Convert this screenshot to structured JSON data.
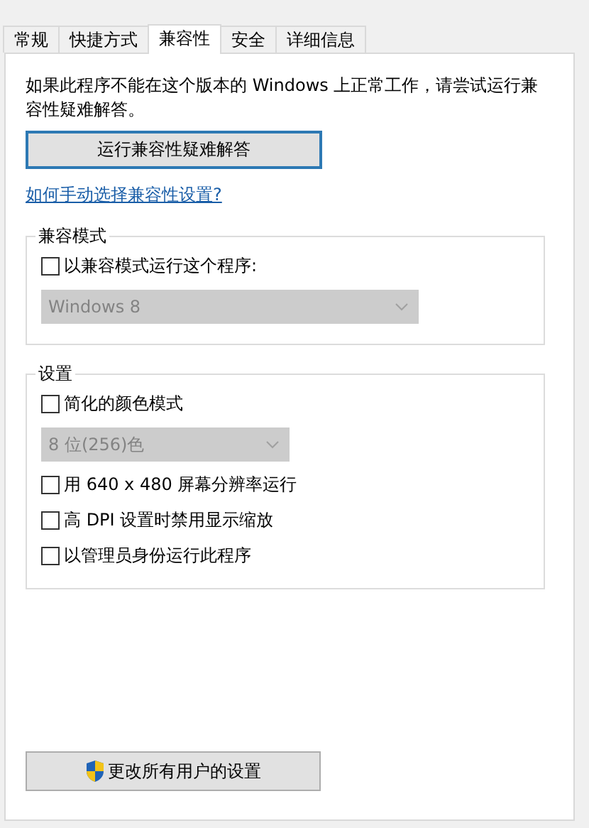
{
  "tabs": [
    {
      "label": "常规",
      "selected": false
    },
    {
      "label": "快捷方式",
      "selected": false
    },
    {
      "label": "兼容性",
      "selected": true
    },
    {
      "label": "安全",
      "selected": false
    },
    {
      "label": "详细信息",
      "selected": false
    }
  ],
  "intro": "如果此程序不能在这个版本的 Windows 上正常工作，请尝试运行兼容性疑难解答。",
  "troubleshoot_button": "运行兼容性疑难解答",
  "help_link": "如何手动选择兼容性设置?",
  "groups": [
    {
      "title": "兼容模式",
      "items": [
        {
          "kind": "checkbox",
          "label": "以兼容模式运行这个程序:",
          "checked": false
        },
        {
          "kind": "dropdown",
          "value": "Windows 8",
          "disabled": true
        }
      ]
    },
    {
      "title": "设置",
      "items": [
        {
          "kind": "checkbox",
          "label": "简化的颜色模式",
          "checked": false
        },
        {
          "kind": "dropdown",
          "value": "8 位(256)色",
          "disabled": true
        },
        {
          "kind": "checkbox",
          "label": "用 640 x 480 屏幕分辨率运行",
          "checked": false
        },
        {
          "kind": "checkbox",
          "label": "高 DPI 设置时禁用显示缩放",
          "checked": false
        },
        {
          "kind": "checkbox",
          "label": "以管理员身份运行此程序",
          "checked": false
        }
      ]
    }
  ],
  "all_users_button": "更改所有用户的设置"
}
